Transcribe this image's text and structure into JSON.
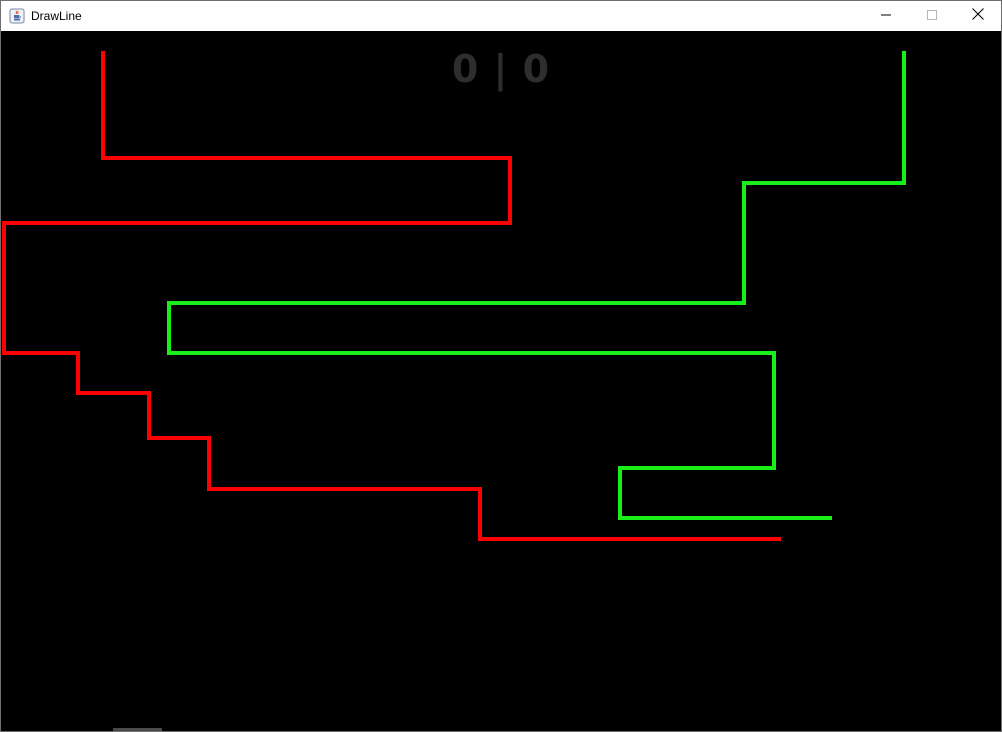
{
  "window": {
    "title": "DrawLine",
    "app_icon": "java-cup-icon",
    "controls": {
      "minimize_icon": "minimize-icon",
      "maximize_icon": "maximize-icon",
      "close_icon": "close-icon"
    }
  },
  "game": {
    "background_color": "#000000",
    "score_left": "0",
    "score_separator": "|",
    "score_right": "0",
    "score_text": "0 | 0",
    "players": [
      {
        "id": "red",
        "color": "#ff0000"
      },
      {
        "id": "green",
        "color": "#18ee18"
      }
    ]
  }
}
